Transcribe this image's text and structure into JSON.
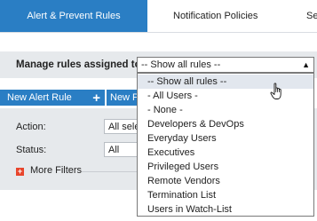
{
  "tabs": [
    {
      "label": "Alert & Prevent Rules",
      "active": true
    },
    {
      "label": "Notification Policies",
      "active": false
    },
    {
      "label": "Se",
      "active": false
    }
  ],
  "manage": {
    "label": "Manage rules assigned to",
    "selected": "-- Show all rules --",
    "options": [
      "-- Show all rules --",
      "- All Users -",
      "- None -",
      "Developers & DevOps",
      "Everyday Users",
      "Executives",
      "Privileged Users",
      "Remote Vendors",
      "Termination List",
      "Users in Watch-List"
    ],
    "hovered_option": "-- Show all rules --"
  },
  "toolbar": {
    "new_alert_label": "New Alert Rule",
    "new_alert_icon": "+",
    "new_prevent_label": "New P"
  },
  "filters": {
    "action_label": "Action:",
    "action_value": "All sele",
    "status_label": "Status:",
    "status_value": "All",
    "more_label": "More Filters",
    "more_icon": "plus-square-icon"
  },
  "colors": {
    "accent": "#2a7ec4",
    "panel": "#e6e9ec",
    "more_icon": "#e8452c"
  }
}
